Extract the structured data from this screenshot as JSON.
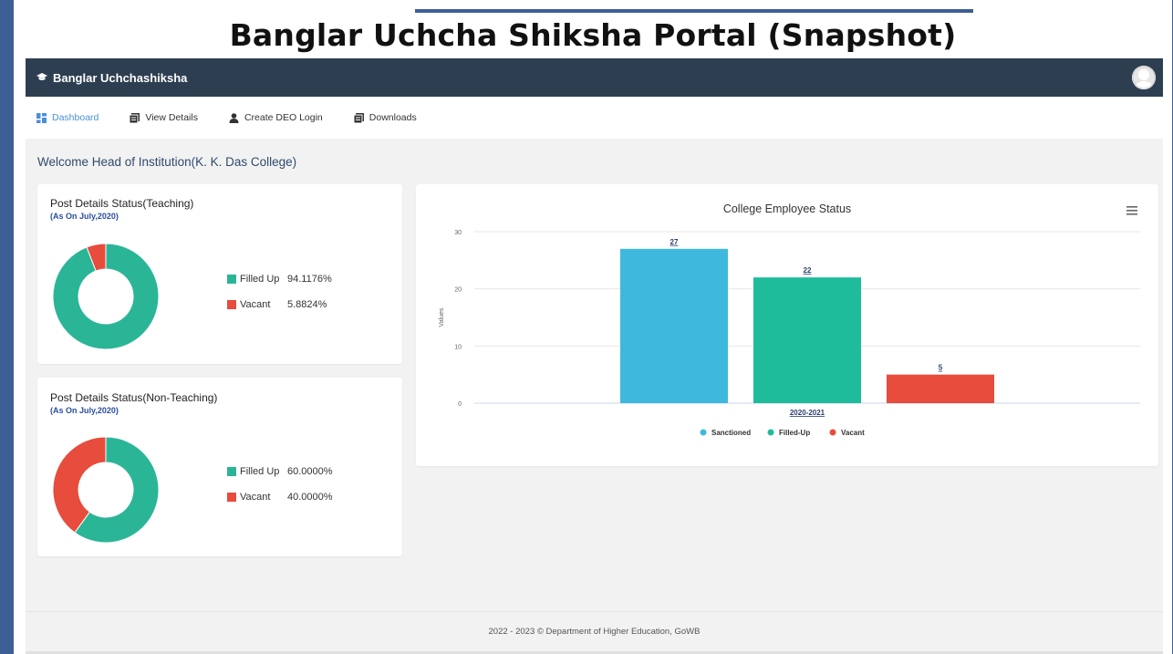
{
  "page": {
    "headline": "Banglar Uchcha Shiksha Portal (Snapshot)"
  },
  "topbar": {
    "brand": "Banglar Uchchashiksha",
    "brand_icon": "graduation-cap-icon",
    "avatar_icon": "user-avatar-icon"
  },
  "nav": {
    "items": [
      {
        "label": "Dashboard",
        "icon": "dashboard-icon",
        "active": true
      },
      {
        "label": "View Details",
        "icon": "document-icon",
        "active": false
      },
      {
        "label": "Create DEO Login",
        "icon": "user-icon",
        "active": false
      },
      {
        "label": "Downloads",
        "icon": "document-icon",
        "active": false
      }
    ]
  },
  "welcome": "Welcome Head of Institution(K. K. Das College)",
  "teaching": {
    "title": "Post Details Status(Teaching)",
    "subtitle": "(As On July,2020)",
    "legend": [
      {
        "label": "Filled Up",
        "value": "94.1176%"
      },
      {
        "label": "Vacant",
        "value": "5.8824%"
      }
    ]
  },
  "nonteaching": {
    "title": "Post Details Status(Non-Teaching)",
    "subtitle": "(As On July,2020)",
    "legend": [
      {
        "label": "Filled Up",
        "value": "60.0000%"
      },
      {
        "label": "Vacant",
        "value": "40.0000%"
      }
    ]
  },
  "employee_chart": {
    "menu_icon": "hamburger-menu-icon"
  },
  "chart_data": [
    {
      "type": "pie",
      "title": "Post Details Status(Teaching)",
      "subtitle": "(As On July,2020)",
      "categories": [
        "Filled Up",
        "Vacant"
      ],
      "values": [
        94.1176,
        5.8824
      ],
      "colors": [
        "#2bb597",
        "#e74c3c"
      ],
      "legend": "right"
    },
    {
      "type": "pie",
      "title": "Post Details Status(Non-Teaching)",
      "subtitle": "(As On July,2020)",
      "categories": [
        "Filled Up",
        "Vacant"
      ],
      "values": [
        60.0,
        40.0
      ],
      "colors": [
        "#2bb597",
        "#e74c3c"
      ],
      "legend": "right"
    },
    {
      "type": "bar",
      "title": "College Employee Status",
      "categories": [
        "2020-2021"
      ],
      "series": [
        {
          "name": "Sanctioned",
          "values": [
            27
          ],
          "color": "#3fb8dd"
        },
        {
          "name": "Filled-Up",
          "values": [
            22
          ],
          "color": "#1fbc9c"
        },
        {
          "name": "Vacant",
          "values": [
            5
          ],
          "color": "#e74c3c"
        }
      ],
      "ylabel": "Values",
      "ylim": [
        0,
        30
      ],
      "yticks": [
        0,
        10,
        20,
        30
      ],
      "grid": true,
      "legend": "bottom"
    }
  ],
  "footer": "2022 - 2023 © Department of Higher Education, GoWB"
}
